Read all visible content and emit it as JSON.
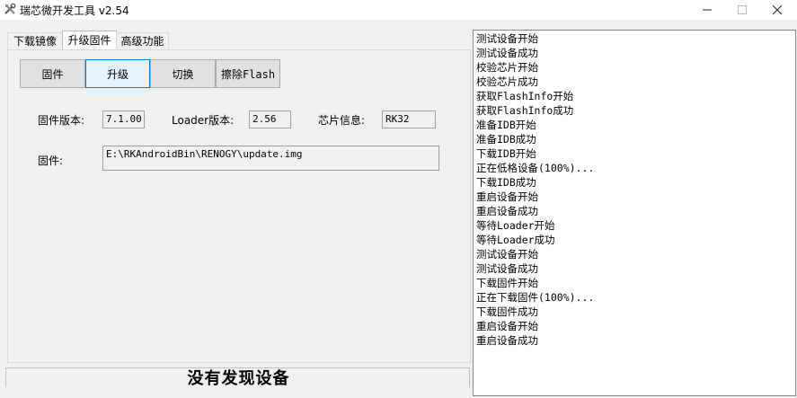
{
  "window": {
    "title": "瑞芯微开发工具 v2.54"
  },
  "tabs": [
    {
      "label": "下载镜像"
    },
    {
      "label": "升级固件"
    },
    {
      "label": "高级功能"
    }
  ],
  "buttons": {
    "firmware": "固件",
    "upgrade": "升级",
    "switch": "切换",
    "erase_flash": "擦除Flash"
  },
  "info": {
    "firmware_version_label": "固件版本:",
    "firmware_version": "7.1.00",
    "loader_version_label": "Loader版本:",
    "loader_version": "2.56",
    "chip_info_label": "芯片信息:",
    "chip_info": "RK32",
    "firmware_path_label": "固件:",
    "firmware_path": "E:\\RKAndroidBin\\RENOGY\\update.img"
  },
  "status": {
    "text": "没有发现设备"
  },
  "log": [
    "测试设备开始",
    "测试设备成功",
    "校验芯片开始",
    "校验芯片成功",
    "获取FlashInfo开始",
    "获取FlashInfo成功",
    "准备IDB开始",
    "准备IDB成功",
    "下载IDB开始",
    "正在低格设备(100%)...",
    "下载IDB成功",
    "重启设备开始",
    "重启设备成功",
    "等待Loader开始",
    "等待Loader成功",
    "测试设备开始",
    "测试设备成功",
    "下载固件开始",
    "正在下载固件(100%)...",
    "下载固件成功",
    "重启设备开始",
    "重启设备成功"
  ],
  "icons": {
    "app": "tools-icon",
    "minimize": "minimize-icon",
    "maximize": "maximize-icon",
    "close": "close-icon"
  }
}
